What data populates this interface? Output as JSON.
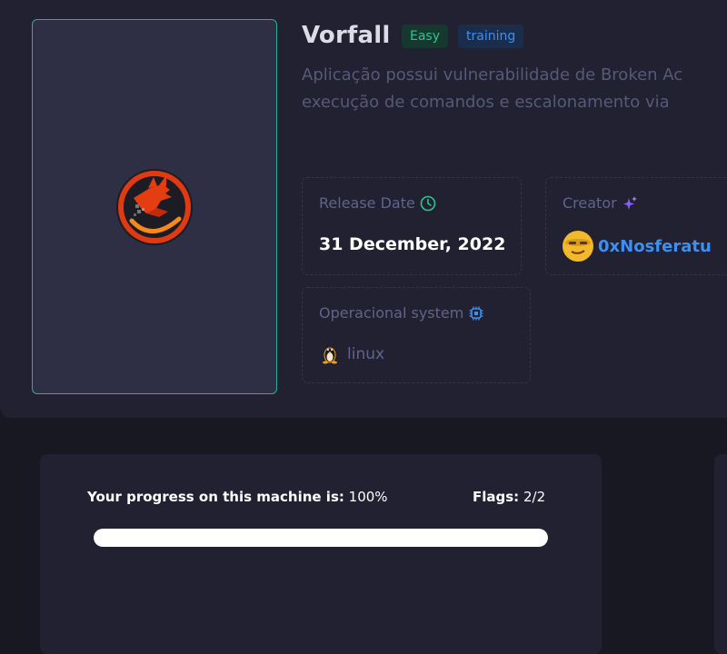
{
  "machine": {
    "name": "Vorfall",
    "difficulty": "Easy",
    "tag": "training",
    "description_line1": "Aplicação possui vulnerabilidade de Broken Ac",
    "description_line2": "execução de comandos e escalonamento via"
  },
  "release": {
    "label": "Release Date",
    "value": "31 December, 2022",
    "icon": "clock-icon"
  },
  "creator": {
    "label": "Creator",
    "name": "0xNosferatu",
    "icon": "sparkle-icon"
  },
  "os": {
    "label": "Operacional system",
    "value": "linux",
    "icon": "chip-icon"
  },
  "progress": {
    "label": "Your progress on this machine is:",
    "value_text": "100%",
    "fraction": 1.0,
    "flags_label": "Flags:",
    "flags_value": "2/2"
  },
  "colors": {
    "accent_green": "#2fc48f",
    "accent_blue": "#3d8ff0",
    "panel_bg": "#212131",
    "page_bg": "#181823"
  }
}
